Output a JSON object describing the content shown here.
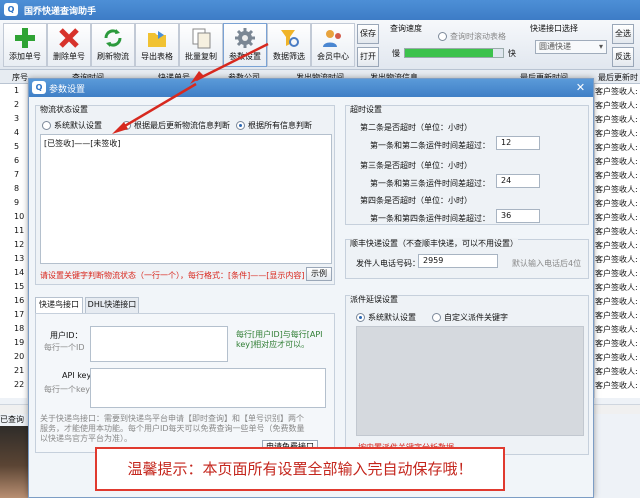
{
  "app": {
    "title": "国乔快递查询助手",
    "logo": "Q"
  },
  "toolbar": {
    "buttons": [
      {
        "label": "添加单号",
        "icon": "plus-icon"
      },
      {
        "label": "删除单号",
        "icon": "delete-x-icon"
      },
      {
        "label": "刷新物流",
        "icon": "refresh-icon"
      },
      {
        "label": "导出表格",
        "icon": "export-table-icon"
      },
      {
        "label": "批量复制",
        "icon": "copy-icon"
      },
      {
        "label": "参数设置",
        "icon": "gear-icon"
      },
      {
        "label": "数据筛选",
        "icon": "filter-icon"
      },
      {
        "label": "会员中心",
        "icon": "member-icon"
      }
    ],
    "save": "保存",
    "open": "打开",
    "speed_label": "查询速度",
    "slow": "慢",
    "fast": "快",
    "auto_scroll": "查询时滚动表格",
    "port_label": "快递接口选择",
    "port_value": "圆通快递",
    "select_all": "全选",
    "invert": "反选"
  },
  "grid": {
    "headers": [
      "序号",
      "查询时间",
      "快递单号",
      "参数公司",
      "发出物流时间",
      "发出物流信息",
      "最后更新时间",
      "最后更新时"
    ],
    "row_numbers": [
      "1",
      "2",
      "3",
      "4",
      "5",
      "6",
      "7",
      "8",
      "9",
      "10",
      "11",
      "12",
      "13",
      "14",
      "15",
      "16",
      "17",
      "18",
      "19",
      "20",
      "21",
      "22"
    ],
    "right_texts": [
      "客户签收人:",
      "客户签收人:",
      "客户签收人:",
      "客户签收人:",
      "客户签收人:",
      "客户签收人:",
      "客户签收人:",
      "客户签收人:",
      "客户签收人:",
      "客户签收人:",
      "客户签收人:",
      "客户签收人:",
      "客户签收人:",
      "客户签收人:",
      "客户签收人:",
      "客户签收人:",
      "客户签收人:",
      "客户签收人:",
      "客户签收人:",
      "客户签收人:",
      "客户签收人:",
      "客户签收人:"
    ],
    "status": "已查询"
  },
  "dialog": {
    "title": "参数设置",
    "status_group": {
      "title": "物流状态设置",
      "options": [
        "系统默认设置",
        "根据最后更新物流信息判断",
        "根据所有信息判断"
      ],
      "selected": 2,
      "text": "[已签收]——[未签收]",
      "hint": "请设置关键字判断物流状态（一行一个），每行格式：[条件]——[显示内容]",
      "example_btn": "示例"
    },
    "timeout_group": {
      "title": "超时设置",
      "rows": [
        {
          "head": "第二条是否超时（单位：小时）",
          "label": "第一条和第二条运件时间差超过：",
          "value": "12"
        },
        {
          "head": "第三条是否超时（单位：小时）",
          "label": "第一条和第三条运件时间差超过：",
          "value": "24"
        },
        {
          "head": "第四条是否超时（单位：小时）",
          "label": "第一条和第四条运件时间差超过：",
          "value": "36"
        }
      ]
    },
    "sf_group": {
      "title": "顺丰快递设置（不查顺丰快递，可以不用设置）",
      "phone_label": "发件人电话号码：",
      "phone_value": "2959",
      "phone_hint": "默认输入电话后4位"
    },
    "tabs": [
      "快递鸟接口",
      "DHL快递接口"
    ],
    "kdn": {
      "user_label": "用户ID：",
      "user_ph": "每行一个ID",
      "api_label": "API key：",
      "api_ph": "每行一个key",
      "side_note": "每行[用户ID]与每行[API key]相对应才可以。",
      "about": "关于快递鸟接口：需要到快递鸟平台申请【即时查询】和【单号识别】两个服务，才能使用本功能。每个用户ID每天可以免费查询一些单号（免费数量以快递鸟官方平台为准）。",
      "apply_btn": "申请免费接口"
    },
    "waybill_group": {
      "title": "派件延误设置",
      "options": [
        "系统默认设置",
        "自定义派件关键字"
      ],
      "selected": 0,
      "hint": "按内置派件关键字分析数据"
    },
    "banner": "温馨提示：本页面所有设置全部输入完自动保存哦！"
  }
}
